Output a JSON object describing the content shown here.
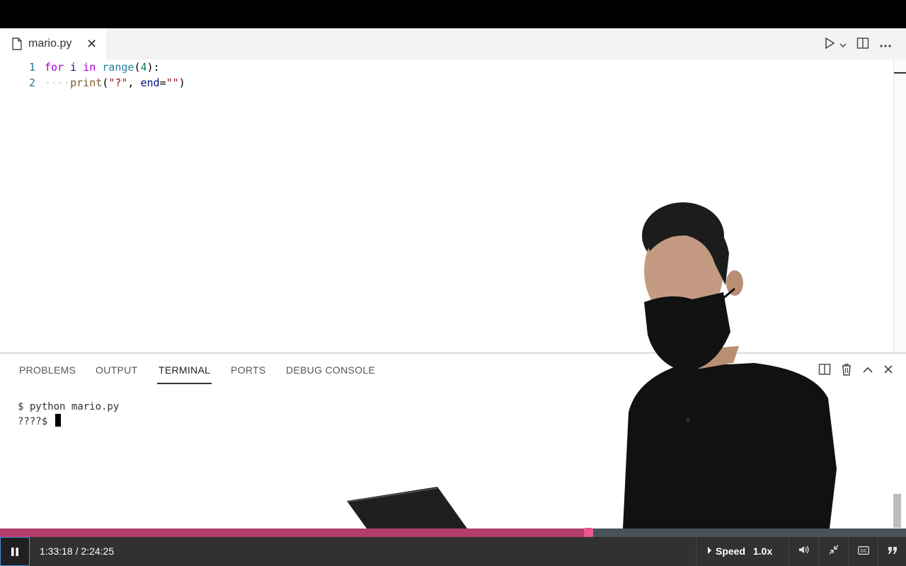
{
  "editor": {
    "tab": {
      "filename": "mario.py",
      "file_icon": "file-icon",
      "close_icon": "close-icon"
    },
    "actions": {
      "run_icon": "play-icon",
      "run_menu_icon": "chevron-down-icon",
      "split_icon": "split-editor-icon",
      "more_icon": "more-icon"
    },
    "code_lines": [
      {
        "number": "1",
        "text": "for i in range(4):"
      },
      {
        "number": "2",
        "text": "····print(\"?\", end=\"\")"
      }
    ],
    "line1": {
      "number": "1",
      "kw_for": "for",
      "sp1": " ",
      "var_i": "i",
      "sp2": " ",
      "kw_in": "in",
      "sp3": " ",
      "fn_range": "range",
      "open": "(",
      "num": "4",
      "close": "):"
    },
    "line2": {
      "number": "2",
      "indent": "····",
      "fn_print": "print",
      "open": "(",
      "str1": "\"?\"",
      "comma": ", ",
      "kw_end": "end",
      "eq": "=",
      "str2": "\"\"",
      "close": ")"
    }
  },
  "panel": {
    "tabs": [
      "PROBLEMS",
      "OUTPUT",
      "TERMINAL",
      "PORTS",
      "DEBUG CONSOLE"
    ],
    "active_tab": "TERMINAL",
    "actions": {
      "split_icon": "split-terminal-icon",
      "trash_icon": "trash-icon",
      "maximize_icon": "chevron-up-icon",
      "close_icon": "close-icon"
    },
    "terminal": {
      "line1": "$ python mario.py",
      "line2": "????$ "
    }
  },
  "player": {
    "progress": 0.649,
    "time_current": "1:33:18",
    "time_separator": " / ",
    "time_total": "2:24:25",
    "speed_label": "Speed",
    "speed_value": "1.0x",
    "icons": [
      "pause-icon",
      "volume-icon",
      "fullscreen-exit-icon",
      "cc-icon",
      "transcript-icon"
    ]
  },
  "colors": {
    "progress_fill": "#b33d6b",
    "progress_knob": "#e8578f",
    "keyword": "#af00db",
    "function": "#795e26"
  }
}
